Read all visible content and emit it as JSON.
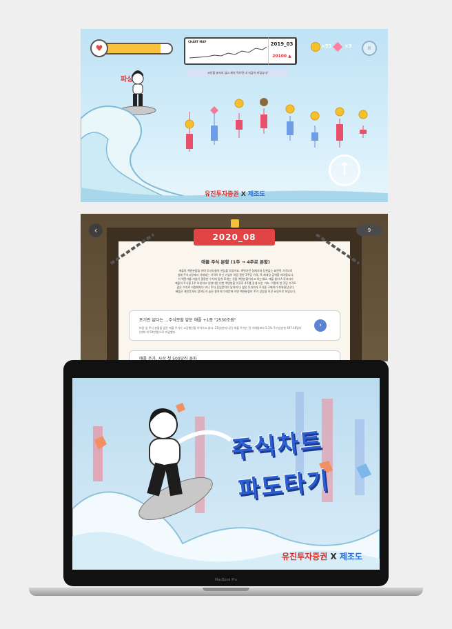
{
  "game": {
    "mini_chart_title": "CHART MAP",
    "date": "2019_03",
    "price": "20100 ▲",
    "coin_count": "×51",
    "gem_count": "×3",
    "pause_icon": "pause-icon",
    "hint": "코인을 놓치지 않고 계속 먹으면 내 자금이 커집니다!",
    "combo": "파상!",
    "hp_fraction": 0.85,
    "up_button": "↑",
    "logo_main": "유진투자증권",
    "logo_x": " X ",
    "logo_partner": "제조도"
  },
  "news": {
    "date": "2020_08",
    "gem_count": "9",
    "back_label": "‹",
    "headline": "애플 주식 분할 (1주 → 4주로 분할)",
    "body_lines": [
      "애플의 액면분할을 하며 투자자들의 관심을 모았어요. 액면가란 실제가와 상관없는 표면적 가격으로",
      "실제 주식시장에서 거래되는 가격이 아닌 기업이 처음 정한 1주당 가격, 즉 최개당 금액을 의미합니다.",
      "이 액면가를 기업이 결정한 수치에 맞게 쪼개는 것을 액면분할이라고 하는데요. 애플 들어 A 투자자가",
      "애플의 주식을 1주 보유하고 있었다면 이번 액면분할 이후로 4주를 갖게 되는 거죠. 이렇게 한 주당 가격도",
      "같은 수치로 저렴해지다 보니 투자 진입문턱이 낮아져 더 많은 투자자가 주식을 구매하기 쉬워졌답니다.",
      "애플은 개인투자자 참여도가 높은 종목이기 때문에 이번 액면분할이 주가 상승을 이끈 요인으로 보입니다."
    ],
    "card1_title": "포기란 없다는 ...주식분할 앞둔 애플 +1종 \"2530조원\"",
    "card1_body": "미달 앞 주식 분할을 앞둔 애플 주가가 고공행진을 이어가고 있다. 21일(현지시간) 애플 주가는 전 거래일보다 5.1% 주가상승한 497.48달러(한화 약 59만원)으로 마감했다.",
    "card1_arrow": "›",
    "card2_title": "애플 주가, 사상 첫 500달러 돌파"
  },
  "laptop": {
    "brand": "MacBook Pro",
    "title_line1": "주식차트",
    "title_line2": "파도타기",
    "logo_main": "유진투자증권",
    "logo_x": " X ",
    "logo_partner": "제조도"
  }
}
